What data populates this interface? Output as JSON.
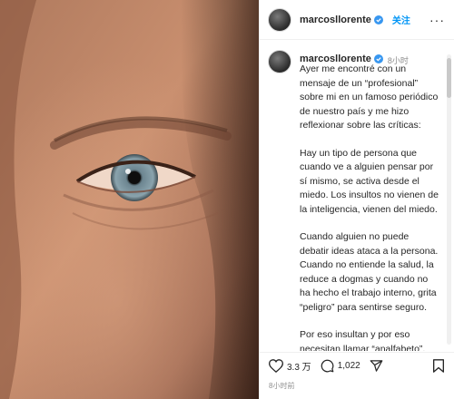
{
  "header": {
    "username": "marcosllorente",
    "follow_label": "关注",
    "more_label": "···"
  },
  "caption": {
    "username": "marcosllorente",
    "time": "8小时",
    "paragraphs": [
      "Ayer me encontré con un mensaje de un “profesional” sobre mi en un famoso periódico de nuestro país y me hizo reflexionar sobre las críticas:",
      "Hay un tipo de persona que cuando ve a alguien pensar por sí mismo, se activa desde el miedo. Los insultos no vienen de la inteligencia, vienen del miedo.",
      "Cuando alguien no puede debatir ideas ataca a la persona. Cuando no entiende la salud, la reduce a dogmas y cuando no ha hecho el trabajo interno, grita “peligro” para sentirse seguro.",
      "Por eso insultan y por eso necesitan llamar “analfabeto”, “peligro” o “negacionista” a quien no se arrodilla"
    ]
  },
  "actions": {
    "likes": "3.3 万",
    "comments": "1,022"
  },
  "footer": {
    "time": "8小时前"
  },
  "colors": {
    "accent": "#0095f6",
    "verified": "#3897f0",
    "text": "#262626",
    "muted": "#8e8e8e"
  }
}
